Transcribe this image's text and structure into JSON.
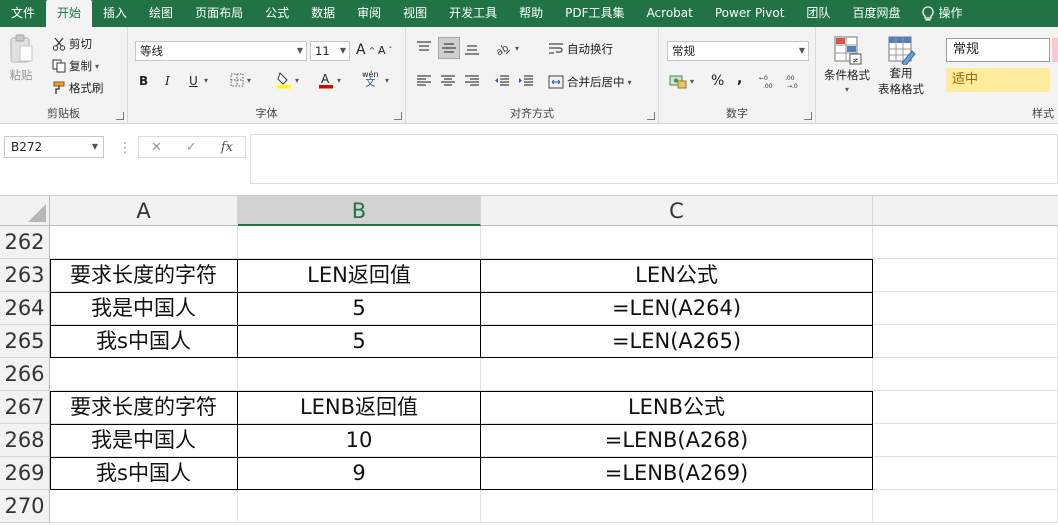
{
  "tabs": [
    "文件",
    "开始",
    "插入",
    "绘图",
    "页面布局",
    "公式",
    "数据",
    "审阅",
    "视图",
    "开发工具",
    "帮助",
    "PDF工具集",
    "Acrobat",
    "Power Pivot",
    "团队",
    "百度网盘",
    "操作"
  ],
  "active_tab": "开始",
  "ribbon": {
    "clipboard": {
      "paste": "粘贴",
      "cut": "剪切",
      "copy": "复制",
      "format_painter": "格式刷",
      "label": "剪贴板"
    },
    "font": {
      "name": "等线",
      "size": "11",
      "grow": "A",
      "shrink": "A",
      "bold": "B",
      "italic": "I",
      "underline": "U",
      "wen": "wén",
      "label": "字体"
    },
    "align": {
      "wrap": "自动换行",
      "merge": "合并后居中",
      "label": "对齐方式"
    },
    "number": {
      "format": "常规",
      "percent": "%",
      "comma": ",",
      "label": "数字"
    },
    "styles": {
      "conditional": "条件格式",
      "table_line1": "套用",
      "table_line2": "表格格式",
      "normal": "常规",
      "neutral": "适中",
      "label": "样式"
    }
  },
  "formula_bar": {
    "name_box": "B272",
    "cancel": "✕",
    "enter": "✓",
    "fx": "fx",
    "value": ""
  },
  "columns": [
    "A",
    "B",
    "C"
  ],
  "selected_column": "B",
  "rows": [
    {
      "num": "262",
      "a": "",
      "b": "",
      "c": ""
    },
    {
      "num": "263",
      "a": "要求长度的字符",
      "b": "LEN返回值",
      "c": "LEN公式"
    },
    {
      "num": "264",
      "a": "我是中国人",
      "b": "5",
      "c": "=LEN(A264)"
    },
    {
      "num": "265",
      "a": "我s中国人",
      "b": "5",
      "c": "=LEN(A265)"
    },
    {
      "num": "266",
      "a": "",
      "b": "",
      "c": ""
    },
    {
      "num": "267",
      "a": "要求长度的字符",
      "b": "LENB返回值",
      "c": "LENB公式"
    },
    {
      "num": "268",
      "a": "我是中国人",
      "b": "10",
      "c": "=LENB(A268)"
    },
    {
      "num": "269",
      "a": "我s中国人",
      "b": "9",
      "c": "=LENB(A269)"
    },
    {
      "num": "270",
      "a": "",
      "b": "",
      "c": ""
    }
  ],
  "colors": {
    "brand": "#217346",
    "ribbon": "#f3f3f3",
    "header": "#f2f2f2",
    "neutral_style": "#ffeb9c"
  }
}
